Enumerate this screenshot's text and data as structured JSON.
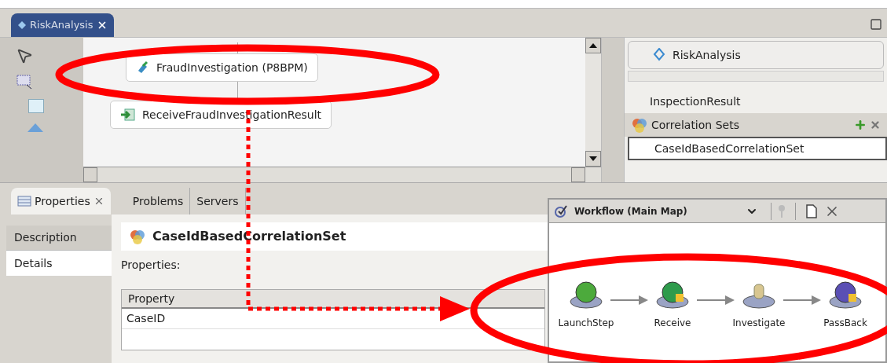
{
  "editor": {
    "tab": {
      "label": "RiskAnalysis",
      "selected": true
    },
    "nodes": [
      {
        "label": "FraudInvestigation (P8BPM)",
        "kind": "invoke"
      },
      {
        "label": "ReceiveFraudInvestigationResult",
        "kind": "receive"
      }
    ]
  },
  "outline": {
    "title": "RiskAnalysis",
    "items": [
      {
        "label": "InspectionResult",
        "kind": "item",
        "selected": false
      },
      {
        "label": "Correlation Sets",
        "kind": "category",
        "selected": false
      },
      {
        "label": "CaseIdBasedCorrelationSet",
        "kind": "item",
        "selected": true
      }
    ]
  },
  "bottom_tabs": [
    {
      "label": "Properties",
      "selected": true
    },
    {
      "label": "Problems",
      "selected": false
    },
    {
      "label": "Servers",
      "selected": false
    }
  ],
  "properties": {
    "side_tabs": [
      {
        "label": "Description",
        "selected": false
      },
      {
        "label": "Details",
        "selected": true
      }
    ],
    "title": "CaseIdBasedCorrelationSet",
    "section_label": "Properties:",
    "table": {
      "columns": [
        "Property"
      ],
      "rows": [
        [
          "CaseID"
        ]
      ]
    }
  },
  "workflow": {
    "title": "Workflow (Main Map)",
    "steps": [
      {
        "label": "LaunchStep",
        "kind": "launch"
      },
      {
        "label": "Receive",
        "kind": "receive"
      },
      {
        "label": "Investigate",
        "kind": "investigate"
      },
      {
        "label": "PassBack",
        "kind": "pass"
      }
    ]
  }
}
